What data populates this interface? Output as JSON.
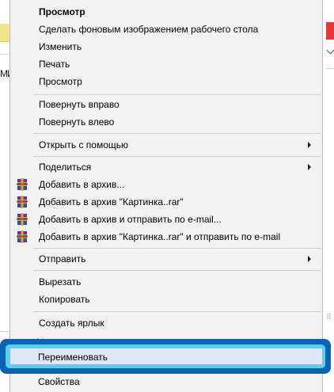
{
  "background": {
    "left_edge_text": "МИ"
  },
  "menu": {
    "groups": [
      {
        "items": [
          {
            "label": "Просмотр",
            "bold": true
          },
          {
            "label": "Сделать фоновым изображением рабочего стола"
          },
          {
            "label": "Изменить"
          },
          {
            "label": "Печать"
          },
          {
            "label": "Просмотр"
          }
        ]
      },
      {
        "items": [
          {
            "label": "Повернуть вправо"
          },
          {
            "label": "Повернуть влево"
          }
        ]
      },
      {
        "items": [
          {
            "label": "Открыть с помощью",
            "submenu": true
          }
        ]
      },
      {
        "items": [
          {
            "label": "Поделиться",
            "submenu": true
          },
          {
            "label": "Добавить в архив...",
            "icon": "winrar-icon"
          },
          {
            "label": "Добавить в архив \"Картинка..rar\"",
            "icon": "winrar-icon"
          },
          {
            "label": "Добавить в архив и отправить по e-mail...",
            "icon": "winrar-icon"
          },
          {
            "label": "Добавить в архив \"Картинка..rar\" и отправить по e-mail",
            "icon": "winrar-icon"
          }
        ]
      },
      {
        "items": [
          {
            "label": "Отправить",
            "submenu": true
          }
        ]
      },
      {
        "items": [
          {
            "label": "Вырезать"
          },
          {
            "label": "Копировать"
          }
        ]
      },
      {
        "items": [
          {
            "label": "Создать ярлык"
          },
          {
            "label": "Удалить"
          },
          {
            "label": "Переименовать",
            "highlighted": true
          }
        ]
      },
      {
        "items": [
          {
            "label": "Свойства"
          }
        ]
      }
    ]
  },
  "colors": {
    "highlight_outer": "#0b63b3",
    "highlight_inner": "#5ad0ef",
    "item_hover": "#dde7f5",
    "menu_bg": "#f2f2f2"
  }
}
